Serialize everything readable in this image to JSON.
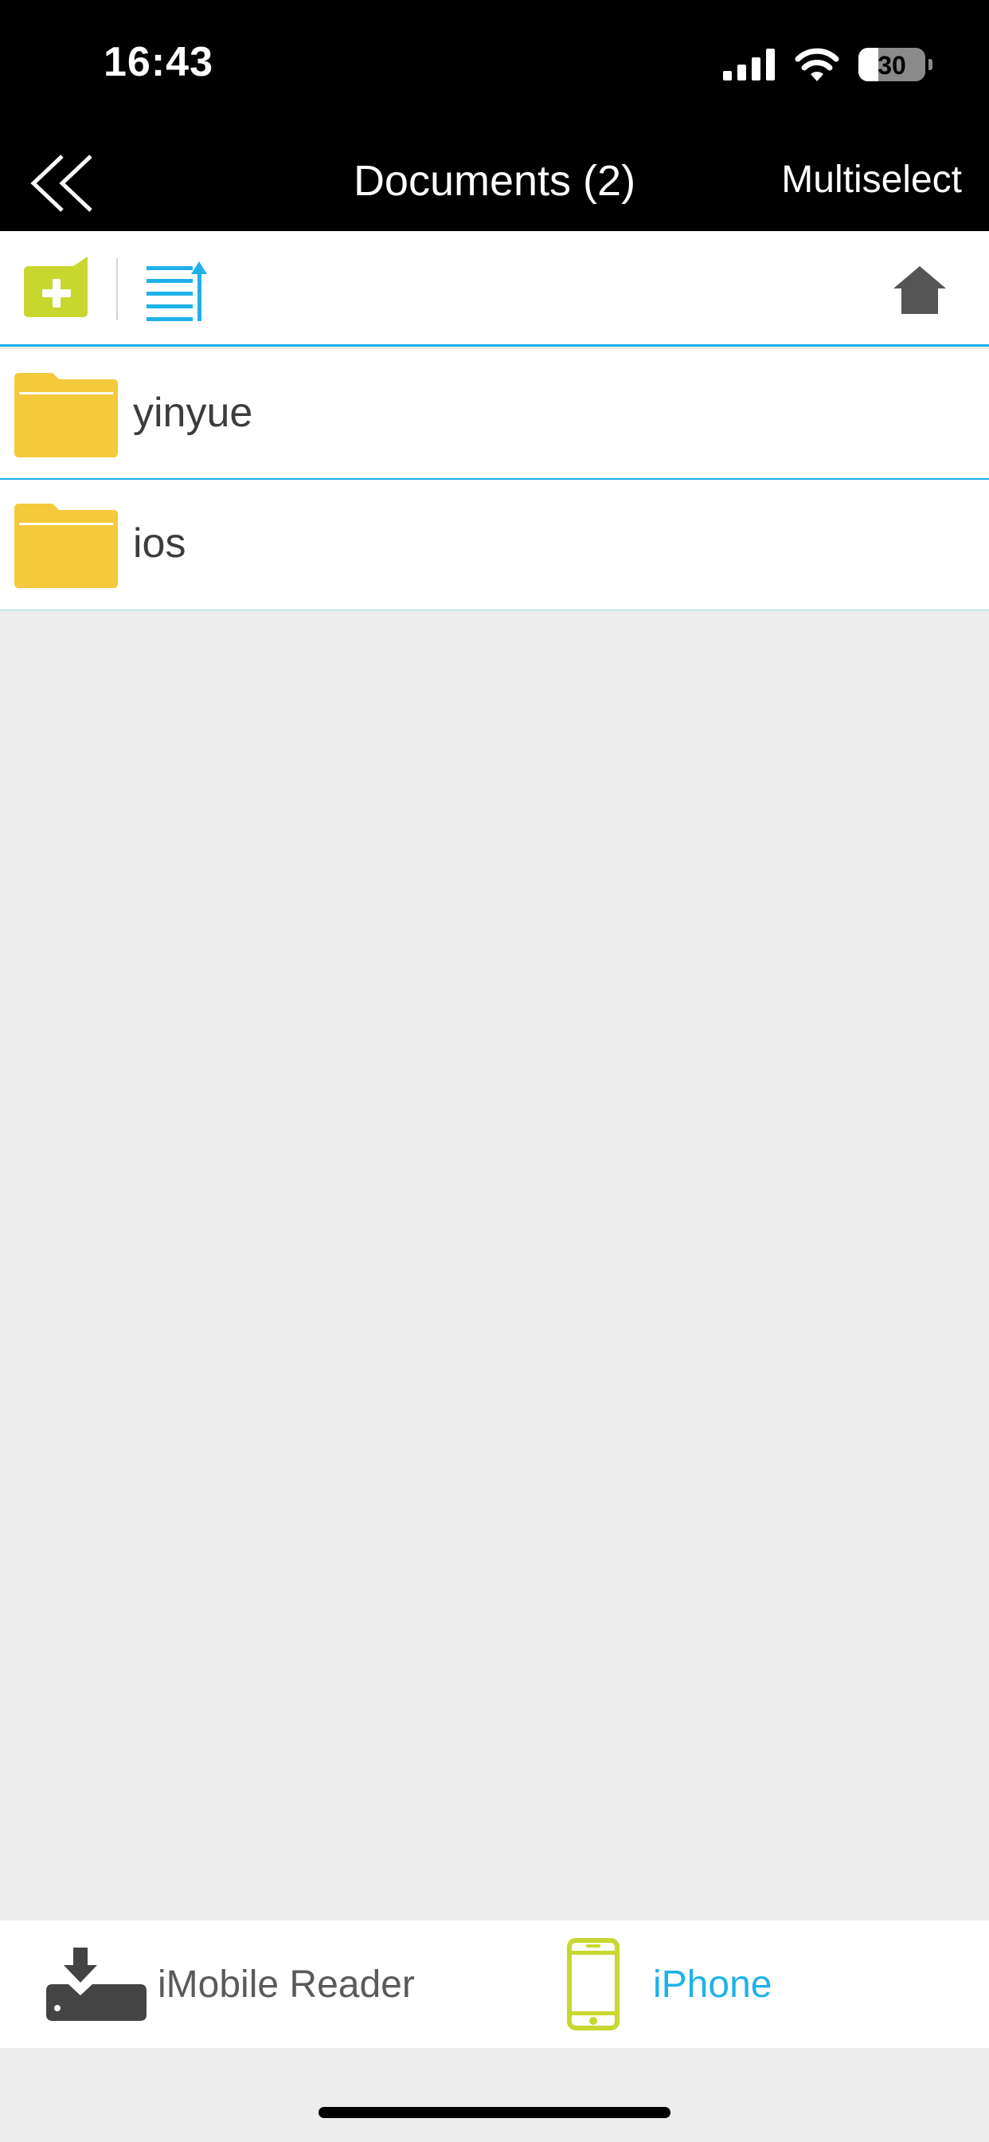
{
  "status_bar": {
    "time": "16:43",
    "battery_level": "30",
    "icons": [
      "signal-icon",
      "wifi-icon",
      "battery-icon"
    ]
  },
  "nav": {
    "back_icon": "double-chevron-left-icon",
    "title": "Documents (2)",
    "multiselect_label": "Multiselect"
  },
  "toolbar": {
    "new_folder_icon": "new-folder-icon",
    "sort_icon": "sort-list-icon",
    "home_icon": "home-icon"
  },
  "files": [
    {
      "name": "yinyue",
      "icon": "folder-icon"
    },
    {
      "name": "ios",
      "icon": "folder-icon"
    }
  ],
  "tabs": [
    {
      "label": "iMobile Reader",
      "icon": "download-drive-icon",
      "active": false
    },
    {
      "label": "iPhone",
      "icon": "iphone-icon",
      "active": true
    }
  ],
  "colors": {
    "accent": "#1fb2e8",
    "lime": "#c8d72e",
    "folder": "#f4c93c",
    "nav_bg": "#000000",
    "content_bg": "#ededed"
  }
}
